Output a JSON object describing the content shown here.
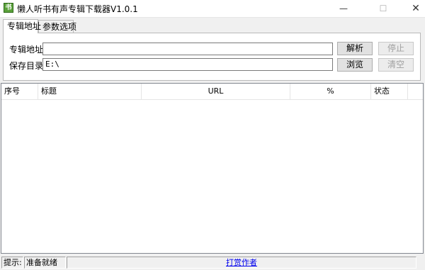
{
  "window": {
    "title": "懒人听书有声专辑下载器V1.0.1",
    "icon_text": "书",
    "controls": {
      "minimize": "—",
      "maximize": "☐",
      "close": "✕"
    }
  },
  "tabs": [
    {
      "label": "专辑地址",
      "active": true
    },
    {
      "label": "参数选项",
      "active": false
    }
  ],
  "form": {
    "album_label": "专辑地址:",
    "album_value": "",
    "save_label": "保存目录:",
    "save_value": "E:\\",
    "parse_button": "解析",
    "stop_button": "停止",
    "browse_button": "浏览",
    "clear_button": "清空"
  },
  "list": {
    "columns": [
      "序号",
      "标题",
      "URL",
      "%",
      "状态"
    ]
  },
  "status": {
    "hint_label": "提示:",
    "message": "准备就绪",
    "link": "打赏作者"
  },
  "colors": {
    "link": "#0000ee",
    "disabled_text": "#a0a0a0",
    "icon_green": "#5aa13a"
  }
}
